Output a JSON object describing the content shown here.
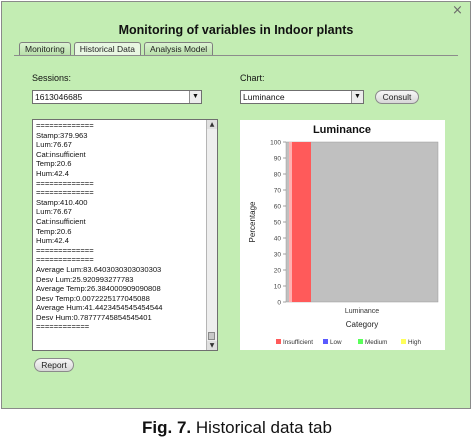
{
  "window": {
    "title": "Monitoring of variables in Indoor plants",
    "close_glyph": "×"
  },
  "tabs": [
    {
      "label": "Monitoring",
      "active": false
    },
    {
      "label": "Historical Data",
      "active": true
    },
    {
      "label": "Analysis Model",
      "active": false
    }
  ],
  "sessions": {
    "label": "Sessions:",
    "selected": "1613046685"
  },
  "chart_select": {
    "label": "Chart:",
    "selected": "Luminance"
  },
  "consult_label": "Consult",
  "report_label": "Report",
  "log_lines": [
    "=============",
    "Stamp:379.963",
    "Lum:76.67",
    "Cat:insufficient",
    "Temp:20.6",
    "Hum:42.4",
    "=============",
    "=============",
    "Stamp:410.400",
    "Lum:76.67",
    "Cat:insufficient",
    "Temp:20.6",
    "Hum:42.4",
    "=============",
    "=============",
    "Average Lum:83.6403030303030303",
    "Desv Lum:25.920993277783",
    "Average Temp:26.384000909090808",
    "Desv Temp:0.0072225177045088",
    "Average Hum:41.4423454545454544",
    "Desv Hum:0.78777745854545401",
    "============"
  ],
  "chart_data": {
    "type": "bar",
    "title": "Luminance",
    "xlabel": "Category",
    "ylabel": "Percentage",
    "categories": [
      "Luminance"
    ],
    "series": [
      {
        "name": "Insufficient",
        "values": [
          100
        ],
        "color": "#ff5a5a"
      },
      {
        "name": "Low",
        "values": [
          0
        ],
        "color": "#5a5aff"
      },
      {
        "name": "Medium",
        "values": [
          0
        ],
        "color": "#5aff5a"
      },
      {
        "name": "High",
        "values": [
          0
        ],
        "color": "#ffff5a"
      }
    ],
    "ylim": [
      0,
      100
    ],
    "yticks": [
      0,
      10,
      20,
      30,
      40,
      50,
      60,
      70,
      80,
      90,
      100
    ],
    "grid": false,
    "legend_position": "bottom",
    "plot_background": "#c0c0c0"
  },
  "caption": {
    "prefix": "Fig. 7.",
    "text": "Historical data tab"
  }
}
